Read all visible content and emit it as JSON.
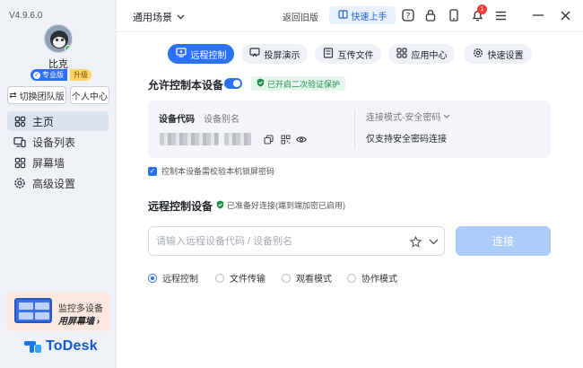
{
  "app": {
    "version": "V4.9.6.0",
    "username": "比克",
    "tier_label": "专业版",
    "upgrade_label": "升级",
    "switch_team_label": "切换团队版",
    "personal_center_label": "个人中心",
    "logo_text": "ToDesk"
  },
  "sidebar": {
    "items": [
      {
        "label": "主页",
        "icon": "home-icon"
      },
      {
        "label": "设备列表",
        "icon": "devices-icon"
      },
      {
        "label": "屏幕墙",
        "icon": "grid-icon"
      },
      {
        "label": "高级设置",
        "icon": "gear-icon"
      }
    ],
    "promo_line1": "监控多设备",
    "promo_line2": "用屏幕墙"
  },
  "topbar": {
    "scene_label": "通用场景",
    "legacy_label": "返回旧版",
    "quickstart_label": "快速上手",
    "notification_count": "1"
  },
  "tabs": [
    {
      "label": "远程控制",
      "icon": "monitor-icon",
      "active": true
    },
    {
      "label": "投屏演示",
      "icon": "cast-icon",
      "active": false
    },
    {
      "label": "互传文件",
      "icon": "file-icon",
      "active": false
    },
    {
      "label": "应用中心",
      "icon": "apps-icon",
      "active": false
    },
    {
      "label": "快速设置",
      "icon": "settings-icon",
      "active": false
    }
  ],
  "allow_control": {
    "title": "允许控制本设备",
    "enabled": true,
    "verify_label": "已开启二次验证保护",
    "device_code_label": "设备代码",
    "device_alias_label": "设备别名",
    "conn_mode_label": "连接模式-安全密码",
    "conn_mode_value": "仅支持安全密码连接",
    "lock_checkbox_label": "控制本设备需校验本机锁屏密码",
    "lock_checkbox_checked": true
  },
  "remote_control": {
    "title": "远程控制设备",
    "ready_text": "已准备好连接(端到端加密已启用)",
    "input_placeholder": "请输入远程设备代码 / 设备别名",
    "connect_label": "连接",
    "modes": [
      {
        "label": "远程控制",
        "selected": true
      },
      {
        "label": "文件传输",
        "selected": false
      },
      {
        "label": "观看模式",
        "selected": false
      },
      {
        "label": "协作模式",
        "selected": false
      }
    ]
  },
  "colors": {
    "accent": "#2a72f3",
    "connect_disabled": "#a9cdf7",
    "sidebar_bg": "#eef1f6",
    "verify_green": "#1e8f4a"
  }
}
